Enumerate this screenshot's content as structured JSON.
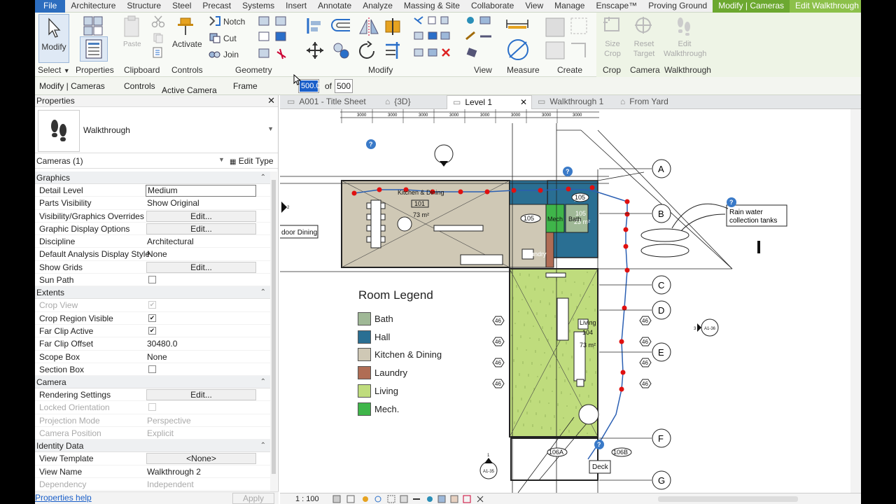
{
  "ribbon_tabs": [
    "File",
    "Architecture",
    "Structure",
    "Steel",
    "Precast",
    "Systems",
    "Insert",
    "Annotate",
    "Analyze",
    "Massing & Site",
    "Collaborate",
    "View",
    "Manage",
    "Enscape™",
    "Proving Ground",
    "Modify | Cameras",
    "Edit Walkthrough"
  ],
  "ribbon": {
    "modify_label": "Modify",
    "select_label": "Select",
    "properties_label": "Properties",
    "clipboard_label": "Clipboard",
    "paste_label": "Paste",
    "activate_label": "Activate",
    "controls_label": "Controls",
    "notch_label": "Notch",
    "cut_label": "Cut",
    "join_label": "Join",
    "geometry_label": "Geometry",
    "modify_panel_label": "Modify",
    "view_label": "View",
    "measure_label": "Measure",
    "create_label": "Create",
    "size_crop_label": "Size Crop",
    "reset_target_label": "Reset Target",
    "edit_walkthrough_label": "Edit Walkthrough",
    "crop_label": "Crop",
    "camera_label": "Camera",
    "walkthrough_label": "Walkthrough"
  },
  "options_bar": {
    "context": "Modify | Cameras",
    "controls_label": "Controls",
    "controls_value": "Active Camera",
    "frame_label": "Frame",
    "frame_value": "500.0",
    "of_label": "of",
    "total_frames": "500"
  },
  "properties": {
    "title": "Properties",
    "type_name": "Walkthrough",
    "instance_filter": "Cameras (1)",
    "edit_type": "Edit Type",
    "sections": [
      {
        "name": "Graphics",
        "rows": [
          {
            "k": "Detail Level",
            "v": "Medium",
            "kind": "field"
          },
          {
            "k": "Parts Visibility",
            "v": "Show Original",
            "kind": "text"
          },
          {
            "k": "Visibility/Graphics Overrides",
            "v": "Edit...",
            "kind": "button"
          },
          {
            "k": "Graphic Display Options",
            "v": "Edit...",
            "kind": "button"
          },
          {
            "k": "Discipline",
            "v": "Architectural",
            "kind": "text"
          },
          {
            "k": "Default Analysis Display Style",
            "v": "None",
            "kind": "text"
          },
          {
            "k": "Show Grids",
            "v": "Edit...",
            "kind": "button"
          },
          {
            "k": "Sun Path",
            "v": "",
            "kind": "check",
            "checked": false
          }
        ]
      },
      {
        "name": "Extents",
        "rows": [
          {
            "k": "Crop View",
            "v": "",
            "kind": "check",
            "checked": true,
            "disabled": true
          },
          {
            "k": "Crop Region Visible",
            "v": "",
            "kind": "check",
            "checked": true
          },
          {
            "k": "Far Clip Active",
            "v": "",
            "kind": "check",
            "checked": true
          },
          {
            "k": "Far Clip Offset",
            "v": "30480.0",
            "kind": "text"
          },
          {
            "k": "Scope Box",
            "v": "None",
            "kind": "text"
          },
          {
            "k": "Section Box",
            "v": "",
            "kind": "check",
            "checked": false
          }
        ]
      },
      {
        "name": "Camera",
        "rows": [
          {
            "k": "Rendering Settings",
            "v": "Edit...",
            "kind": "button"
          },
          {
            "k": "Locked Orientation",
            "v": "",
            "kind": "check",
            "checked": false,
            "disabled": true
          },
          {
            "k": "Projection Mode",
            "v": "Perspective",
            "kind": "text",
            "disabled": true
          },
          {
            "k": "Camera Position",
            "v": "Explicit",
            "kind": "text",
            "disabled": true
          }
        ]
      },
      {
        "name": "Identity Data",
        "rows": [
          {
            "k": "View Template",
            "v": "<None>",
            "kind": "button"
          },
          {
            "k": "View Name",
            "v": "Walkthrough 2",
            "kind": "text"
          },
          {
            "k": "Dependency",
            "v": "Independent",
            "kind": "text",
            "disabled": true
          }
        ]
      }
    ],
    "help_link": "Properties help",
    "apply_label": "Apply"
  },
  "view_tabs": [
    {
      "label": "A001 - Title Sheet",
      "active": false
    },
    {
      "label": "{3D}",
      "active": false
    },
    {
      "label": "Level 1",
      "active": true
    },
    {
      "label": "Walkthrough 1",
      "active": false
    },
    {
      "label": "From Yard",
      "active": false
    }
  ],
  "plan": {
    "dims": [
      "3000",
      "3000",
      "3000",
      "3000",
      "3000",
      "3000",
      "3000",
      "3000"
    ],
    "grid_labels": [
      "A",
      "B",
      "C",
      "D",
      "E",
      "F",
      "G"
    ],
    "room_labels": {
      "kitchen": "Kitchen & Dining",
      "kitchen_num": "101",
      "kitchen_area": "73 m²",
      "hall": "Hall",
      "hall_num": "105",
      "hall_area": "23 m²",
      "mech": "Mech",
      "bath": "Bath",
      "laundry": "Laundry",
      "living": "Living",
      "living_num": "104",
      "living_area": "73 m²",
      "tag_105": "105",
      "tag_106a": "106A",
      "tag_106b": "106B",
      "deck": "Deck",
      "outdoor": "door Dining",
      "tag_46": "46"
    },
    "rain_note": "Rain water collection tanks",
    "rain_note_line1": "Rain water",
    "rain_note_line2": "collection tanks",
    "section_ref1": "A1-36",
    "section_ref1_num": "3",
    "section_ref2": "A1-35",
    "section_ref2_num": "1",
    "elev_num": "2"
  },
  "legend": {
    "title": "Room Legend",
    "items": [
      {
        "name": "Bath",
        "color": "#9fb896"
      },
      {
        "name": "Hall",
        "color": "#2a6f93"
      },
      {
        "name": "Kitchen & Dining",
        "color": "#cfc8b5"
      },
      {
        "name": "Laundry",
        "color": "#b06d55"
      },
      {
        "name": "Living",
        "color": "#bfdc7d"
      },
      {
        "name": "Mech.",
        "color": "#3fb54a"
      }
    ]
  },
  "status": {
    "scale": "1 : 100"
  }
}
